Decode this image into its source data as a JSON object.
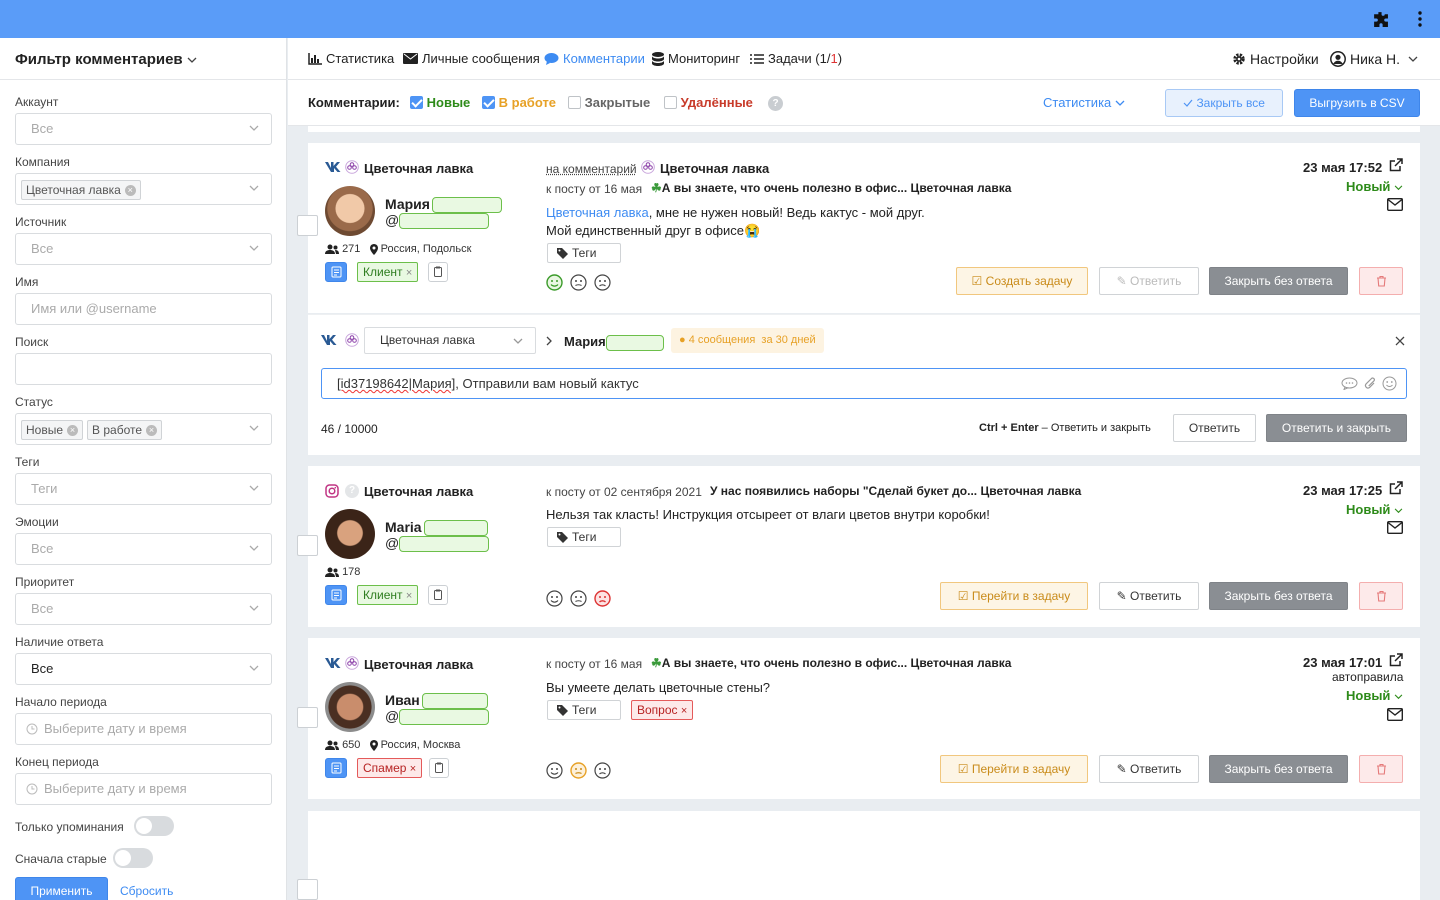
{
  "sidebar": {
    "title": "Фильтр комментариев",
    "filters": {
      "account": {
        "label": "Аккаунт",
        "value": "Все"
      },
      "company": {
        "label": "Компания",
        "chip": "Цветочная лавка"
      },
      "source": {
        "label": "Источник",
        "value": "Все"
      },
      "name": {
        "label": "Имя",
        "placeholder": "Имя или @username"
      },
      "search": {
        "label": "Поиск",
        "value": ""
      },
      "status": {
        "label": "Статус",
        "chips": [
          "Новые",
          "В работе"
        ]
      },
      "tags": {
        "label": "Теги",
        "value": "Теги"
      },
      "emotions": {
        "label": "Эмоции",
        "value": "Все"
      },
      "priority": {
        "label": "Приоритет",
        "value": "Все"
      },
      "has_reply": {
        "label": "Наличие ответа",
        "value": "Все"
      },
      "period_start": {
        "label": "Начало периода",
        "placeholder": "Выберите дату и время"
      },
      "period_end": {
        "label": "Конец периода",
        "placeholder": "Выберите дату и время"
      },
      "mentions_only": {
        "label": "Только упоминания"
      },
      "old_first": {
        "label": "Сначала старые"
      }
    },
    "apply_label": "Применить",
    "reset_label": "Сбросить"
  },
  "nav": {
    "stats": "Статистика",
    "messages": "Личные сообщения",
    "comments": "Комментарии",
    "monitoring": "Мониторинг",
    "tasks_label": "Задачи (",
    "tasks_count_a": "1",
    "tasks_sep": "/",
    "tasks_count_b": "1",
    "tasks_close": ")",
    "settings": "Настройки",
    "user": "Ника Н."
  },
  "filterbar": {
    "label": "Комментарии:",
    "new": "Новые",
    "in_work": "В работе",
    "closed": "Закрытые",
    "deleted": "Удалённые",
    "stats_link": "Статистика",
    "close_all": "Закрыть все",
    "export": "Выгрузить в CSV"
  },
  "comments": [
    {
      "page": "Цветочная лавка",
      "user": "Мария",
      "at": "@",
      "followers": "271",
      "location": "Россия, Подольск",
      "label_tag": "Клиент",
      "context_prefix": "на комментарий",
      "context_page": "Цветочная лавка",
      "post_prefix": "к посту от 16 мая",
      "post_title": "А вы знаете, что очень полезно в офис... Цветочная лавка",
      "text_link": "Цветочная лавка",
      "text": ", мне не нужен новый! Ведь кактус - мой друг.",
      "text2": "Мой единственный друг в офисе😭",
      "tags_label": "Теги",
      "date": "23 мая 17:52",
      "status": "Новый",
      "task_btn": "Создать задачу",
      "reply_btn": "Ответить",
      "close_btn": "Закрыть без ответа"
    },
    {
      "page": "Цветочная лавка",
      "user": "Maria",
      "at": "@",
      "followers": "178",
      "label_tag": "Клиент",
      "post_prefix": "к посту от 02 сентября 2021",
      "post_title": "У нас появились наборы \"Сделай букет до... Цветочная лавка",
      "text": "Нельзя так класть! Инструкция отсыреет от влаги цветов внутри коробки!",
      "tags_label": "Теги",
      "date": "23 мая 17:25",
      "status": "Новый",
      "task_btn": "Перейти в задачу",
      "reply_btn": "Ответить",
      "close_btn": "Закрыть без ответа"
    },
    {
      "page": "Цветочная лавка",
      "user": "Иван",
      "at": "@",
      "followers": "650",
      "location": "Россия, Москва",
      "label_tag": "Спамер",
      "post_prefix": "к посту от 16 мая",
      "post_title": "А вы знаете, что очень полезно в офис... Цветочная лавка",
      "text": "Вы умеете делать цветочные стены?",
      "tags_label": "Теги",
      "extra_tag": "Вопрос",
      "date": "23 мая 17:01",
      "sub": "автоправила",
      "status": "Новый",
      "task_btn": "Перейти в задачу",
      "reply_btn": "Ответить",
      "close_btn": "Закрыть без ответа"
    }
  ],
  "reply_panel": {
    "account": "Цветочная лавка",
    "recipient": "Мария",
    "badge": "4 сообщения",
    "badge_sub": "за 30 дней",
    "text_prefix": "[id37198642|Мария]",
    "text": ", Отправили вам новый кактус",
    "counter": "46 / 10000",
    "hint_keys": "Ctrl + Enter",
    "hint_text": "– Ответить и закрыть",
    "reply": "Ответить",
    "reply_close": "Ответить и закрыть"
  },
  "colors": {
    "accent": "#4e94f5",
    "topbar": "#5a9cf8",
    "ok": "#2e8b1a",
    "warn": "#e7a126",
    "danger": "#d33"
  }
}
